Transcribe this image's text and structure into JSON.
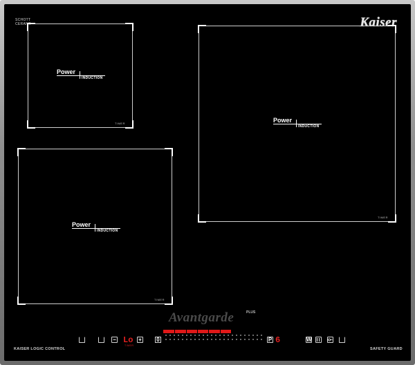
{
  "branding": {
    "schott_line1": "SCHOTT",
    "schott_line2": "CERAN®",
    "maker": "Kaiser",
    "series": "Avantgarde",
    "series_plus": "PLUS"
  },
  "zones": [
    {
      "id": "top-left",
      "logo_power": "Power",
      "logo_induction": "INDUCTION",
      "timer": "TIMER"
    },
    {
      "id": "bottom-left",
      "logo_power": "Power",
      "logo_induction": "INDUCTION",
      "timer": "TIMER"
    },
    {
      "id": "right",
      "logo_power": "Power",
      "logo_induction": "INDUCTION",
      "timer": "TIMER"
    }
  ],
  "controls": {
    "left_label": "KAISER LOGIC CONTROL",
    "right_label": "SAFETY GUARD",
    "minus": "−",
    "plus": "+",
    "timer_display": "Lo",
    "timer_label": "TIMER",
    "zero": "0",
    "p_key": "P",
    "power_level": "6",
    "w_key": "W",
    "colors": {
      "display": "#e02020",
      "glass": "#000000",
      "frame": "#8f8f8f"
    }
  }
}
